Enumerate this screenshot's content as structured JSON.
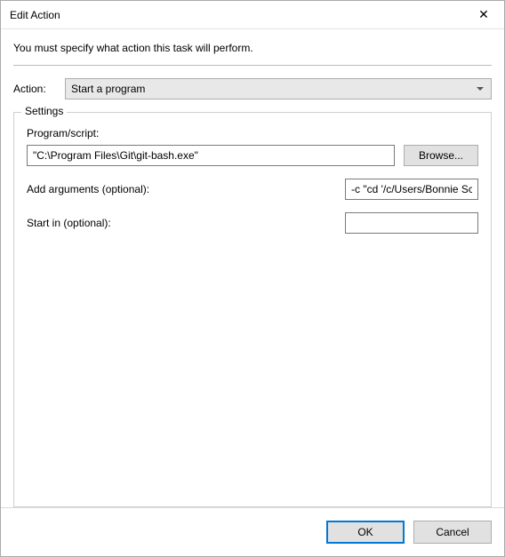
{
  "window": {
    "title": "Edit Action",
    "close_glyph": "✕"
  },
  "intro": "You must specify what action this task will perform.",
  "action": {
    "label": "Action:",
    "selected": "Start a program"
  },
  "settings": {
    "legend": "Settings",
    "program_label": "Program/script:",
    "program_value": "\"C:\\Program Files\\Git\\git-bash.exe\"",
    "browse_label": "Browse...",
    "arguments_label": "Add arguments (optional):",
    "arguments_value": "-c \"cd '/c/Users/Bonnie Sc",
    "startin_label": "Start in (optional):",
    "startin_value": ""
  },
  "buttons": {
    "ok": "OK",
    "cancel": "Cancel"
  }
}
